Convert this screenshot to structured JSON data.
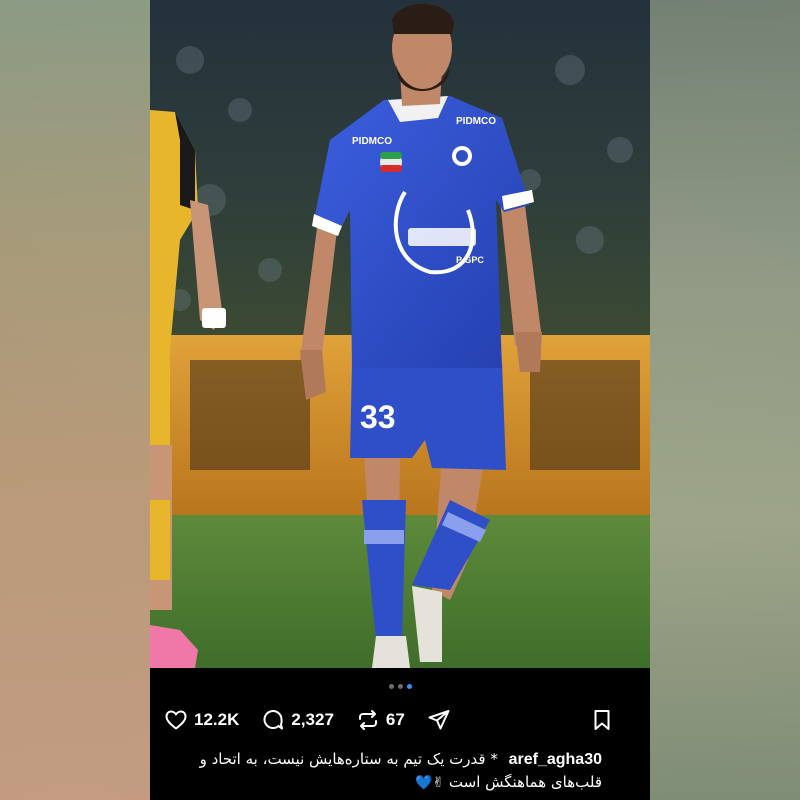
{
  "post": {
    "image": {
      "subject": "footballer-in-blue-kit",
      "jersey_sponsor": "PIDMCO",
      "shirt_text": "P GPC",
      "shorts_number": "33"
    },
    "carousel": {
      "count": 3,
      "active": 2
    },
    "actions": {
      "likes": "12.2K",
      "comments": "2,327",
      "reposts": "67",
      "like_icon": "heart-icon",
      "comment_icon": "comment-bubble-icon",
      "repost_icon": "repost-arrows-icon",
      "share_icon": "send-paper-plane-icon",
      "save_icon": "bookmark-icon"
    },
    "caption": {
      "username": "aref_agha30",
      "text": "* قدرت یک تیم به ستاره‌هایش نیست، به اتحاد و قلب‌های هماهنگش است",
      "emoji": "✌💙"
    }
  },
  "colors": {
    "panel_bg": "#000000",
    "text": "#ffffff",
    "active_dot": "#3a8ef6",
    "kit_blue": "#2f4fc9"
  }
}
